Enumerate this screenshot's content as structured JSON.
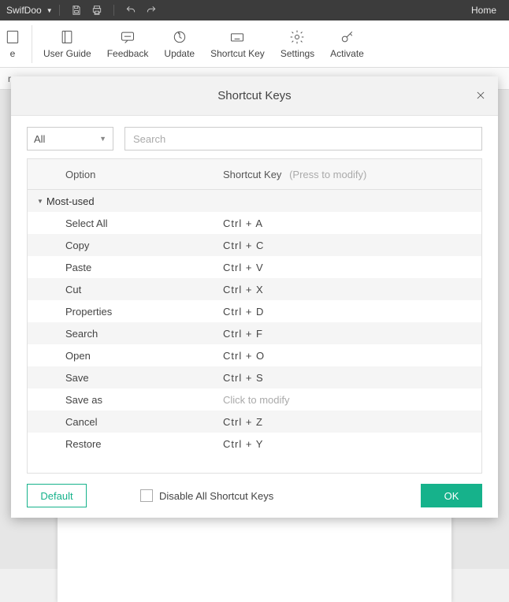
{
  "titlebar": {
    "app_name": "SwifDoo",
    "home_tab": "Home"
  },
  "ribbon": {
    "partial": "e",
    "items": [
      {
        "label": "User Guide",
        "icon": "book"
      },
      {
        "label": "Feedback",
        "icon": "message"
      },
      {
        "label": "Update",
        "icon": "refresh"
      },
      {
        "label": "Shortcut Key",
        "icon": "keyboard"
      },
      {
        "label": "Settings",
        "icon": "gear"
      },
      {
        "label": "Activate",
        "icon": "key"
      }
    ]
  },
  "doc_tab": "mp",
  "modal": {
    "title": "Shortcut Keys",
    "filter_value": "All",
    "search_placeholder": "Search",
    "header_option": "Option",
    "header_key": "Shortcut Key",
    "header_hint": "(Press to modify)",
    "group_name": "Most-used",
    "rows": [
      {
        "opt": "Select All",
        "key": "Ctrl + A"
      },
      {
        "opt": "Copy",
        "key": "Ctrl + C"
      },
      {
        "opt": "Paste",
        "key": "Ctrl + V"
      },
      {
        "opt": "Cut",
        "key": "Ctrl + X"
      },
      {
        "opt": "Properties",
        "key": "Ctrl + D"
      },
      {
        "opt": "Search",
        "key": "Ctrl + F"
      },
      {
        "opt": "Open",
        "key": "Ctrl + O"
      },
      {
        "opt": "Save",
        "key": "Ctrl + S"
      },
      {
        "opt": "Save as",
        "key": "Click to modify",
        "hint": true
      },
      {
        "opt": "Cancel",
        "key": "Ctrl + Z"
      },
      {
        "opt": "Restore",
        "key": "Ctrl + Y"
      }
    ],
    "default_btn": "Default",
    "disable_label": "Disable All Shortcut Keys",
    "ok_btn": "OK"
  }
}
